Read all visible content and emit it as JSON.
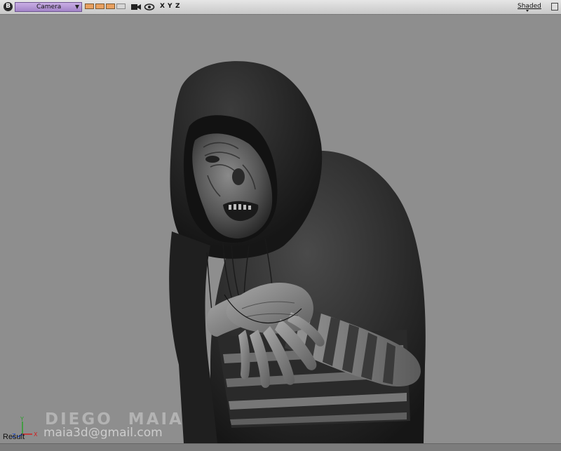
{
  "toolbar": {
    "badge": "B",
    "camera_select": "Camera",
    "axes": [
      "X",
      "Y",
      "Z"
    ],
    "shading_menu": "Shaded"
  },
  "viewport": {
    "result_label": "Result",
    "axis_gizmo": {
      "y": "Y",
      "z": "Z",
      "x": "X"
    },
    "watermark_name": "DIEGO  MAIA",
    "watermark_email": "maia3d@gmail.com"
  },
  "colors": {
    "viewport_bg": "#8e8e8e",
    "camera_select": "#b596d6",
    "swatch": "#e8a060"
  },
  "icons": [
    "camera-icon",
    "eye-icon",
    "maximize-icon"
  ]
}
